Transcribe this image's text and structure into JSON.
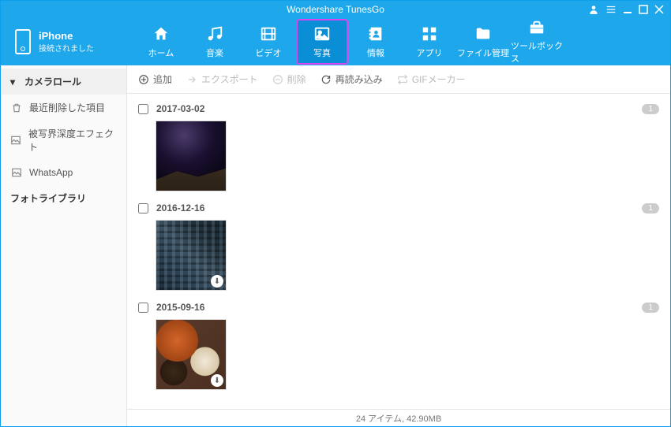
{
  "app": {
    "title": "Wondershare TunesGo"
  },
  "device": {
    "name": "iPhone",
    "status": "接続されました"
  },
  "nav": [
    {
      "key": "home",
      "label": "ホーム"
    },
    {
      "key": "music",
      "label": "音楽"
    },
    {
      "key": "video",
      "label": "ビデオ"
    },
    {
      "key": "photo",
      "label": "写真",
      "active": true
    },
    {
      "key": "info",
      "label": "情報"
    },
    {
      "key": "apps",
      "label": "アプリ"
    },
    {
      "key": "files",
      "label": "ファイル管理"
    },
    {
      "key": "tools",
      "label": "ツールボックス"
    }
  ],
  "sidebar": {
    "camera_roll": "カメラロール",
    "recently_deleted": "最近削除した項目",
    "depth_effect": "被写界深度エフェクト",
    "whatsapp": "WhatsApp",
    "photo_library": "フォトライブラリ"
  },
  "toolbar": {
    "add": "追加",
    "export": "エクスポート",
    "delete": "削除",
    "reload": "再読み込み",
    "gifmaker": "GIFメーカー"
  },
  "sections": [
    {
      "date": "2017-03-02",
      "count": "1",
      "thumb": "night"
    },
    {
      "date": "2016-12-16",
      "count": "1",
      "thumb": "city"
    },
    {
      "date": "2015-09-16",
      "count": "1",
      "thumb": "food"
    }
  ],
  "statusbar": "24 アイテム, 42.90MB"
}
